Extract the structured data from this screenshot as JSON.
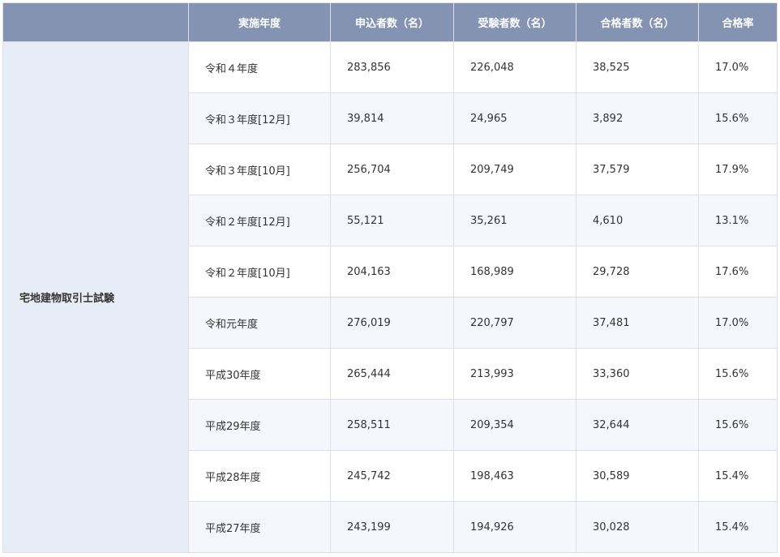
{
  "table": {
    "headers": [
      "",
      "実施年度",
      "申込者数（名）",
      "受験者数（名）",
      "合格者数（名）",
      "合格率"
    ],
    "exam_name": "宅地建物取引士試験",
    "rows": [
      {
        "year": "令和４年度",
        "applicants": "283,856",
        "examinees": "226,048",
        "passers": "38,525",
        "rate": "17.0%"
      },
      {
        "year": "令和３年度[12月]",
        "applicants": "39,814",
        "examinees": "24,965",
        "passers": "3,892",
        "rate": "15.6%"
      },
      {
        "year": "令和３年度[10月]",
        "applicants": "256,704",
        "examinees": "209,749",
        "passers": "37,579",
        "rate": "17.9%"
      },
      {
        "year": "令和２年度[12月]",
        "applicants": "55,121",
        "examinees": "35,261",
        "passers": "4,610",
        "rate": "13.1%"
      },
      {
        "year": "令和２年度[10月]",
        "applicants": "204,163",
        "examinees": "168,989",
        "passers": "29,728",
        "rate": "17.6%"
      },
      {
        "year": "令和元年度",
        "applicants": "276,019",
        "examinees": "220,797",
        "passers": "37,481",
        "rate": "17.0%"
      },
      {
        "year": "平成30年度",
        "applicants": "265,444",
        "examinees": "213,993",
        "passers": "33,360",
        "rate": "15.6%"
      },
      {
        "year": "平成29年度",
        "applicants": "258,511",
        "examinees": "209,354",
        "passers": "32,644",
        "rate": "15.6%"
      },
      {
        "year": "平成28年度",
        "applicants": "245,742",
        "examinees": "198,463",
        "passers": "30,589",
        "rate": "15.4%"
      },
      {
        "year": "平成27年度",
        "applicants": "243,199",
        "examinees": "194,926",
        "passers": "30,028",
        "rate": "15.4%"
      }
    ]
  },
  "colors": {
    "header_bg": "#8593b3",
    "exam_cell_bg": "#e8ecf6",
    "stripe_bg": "#f5f7fc",
    "border": "#dcdfe6"
  }
}
